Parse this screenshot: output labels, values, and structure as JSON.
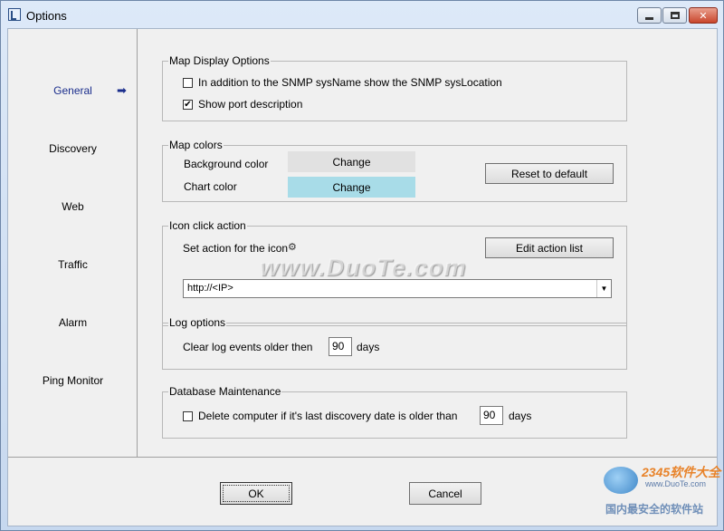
{
  "window": {
    "title": "Options"
  },
  "sidebar": {
    "items": [
      {
        "label": "General",
        "active": true
      },
      {
        "label": "Discovery"
      },
      {
        "label": "Web"
      },
      {
        "label": "Traffic"
      },
      {
        "label": "Alarm"
      },
      {
        "label": "Ping Monitor"
      }
    ],
    "active_arrow_icon": "arrow-right-icon"
  },
  "map_display": {
    "title": "Map Display Options",
    "opt_syslocation": {
      "label": "In addition to the SNMP sysName show the SNMP sysLocation",
      "checked": false
    },
    "opt_port_desc": {
      "label": "Show port description",
      "checked": true
    }
  },
  "map_colors": {
    "title": "Map colors",
    "background_label": "Background color",
    "background_button": "Change",
    "background_color": "#e1e1e1",
    "chart_label": "Chart color",
    "chart_button": "Change",
    "chart_color": "#a8dce8",
    "reset_button": "Reset to default"
  },
  "icon_click": {
    "title": "Icon click action",
    "set_action_label": "Set action for the icon",
    "gear_icon": "gear-icon",
    "edit_button": "Edit action list",
    "action_value": "http://<IP>"
  },
  "log_options": {
    "title": "Log options",
    "label": "Clear log events older then",
    "days_value": "90",
    "days_unit": "days"
  },
  "db_maintenance": {
    "title": "Database Maintenance",
    "label": "Delete computer if it's last discovery date is older than",
    "checked": false,
    "days_value": "90",
    "days_unit": "days"
  },
  "footer": {
    "ok_label": "OK",
    "cancel_label": "Cancel"
  },
  "watermark": {
    "text": "www.DuoTe.com"
  },
  "logo": {
    "brand": "2345软件大全",
    "url": "www.DuoTe.com",
    "tagline": "国内最安全的软件站"
  }
}
